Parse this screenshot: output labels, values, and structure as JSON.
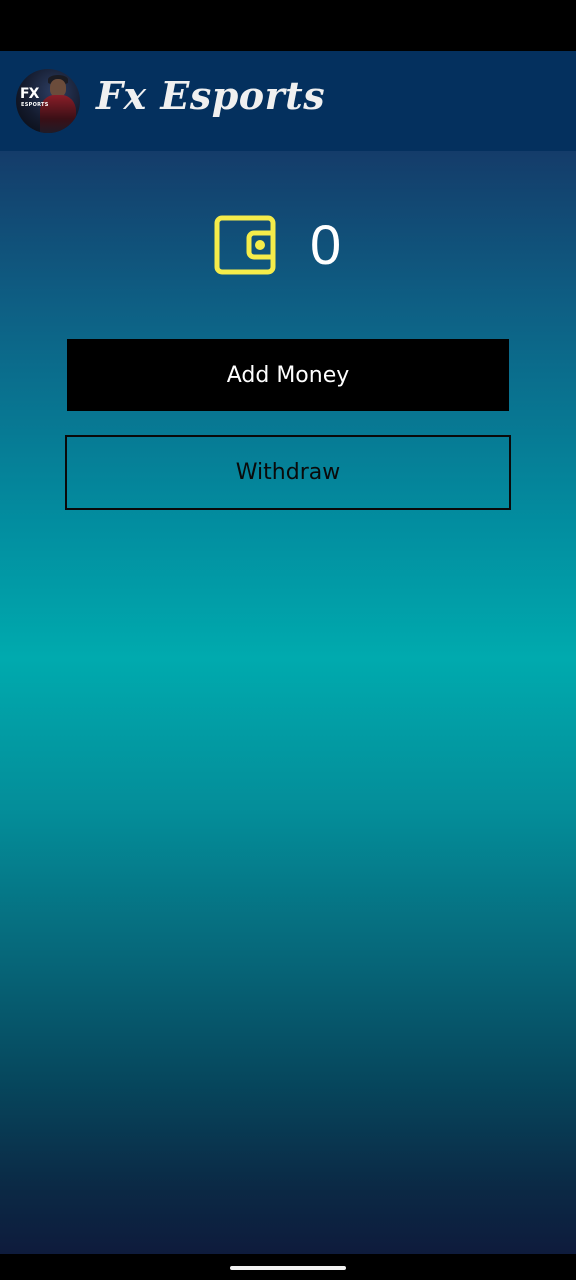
{
  "app": {
    "title": "Fx Esports",
    "logo_text": "FX",
    "logo_subtext": "ESPORTS"
  },
  "wallet": {
    "icon": "wallet-icon",
    "balance": "0",
    "icon_color": "#f5ec4a"
  },
  "actions": {
    "add_money_label": "Add Money",
    "withdraw_label": "Withdraw"
  },
  "colors": {
    "header": "#04305e",
    "accent_teal": "#00aaae",
    "primary_button": "#000000"
  }
}
